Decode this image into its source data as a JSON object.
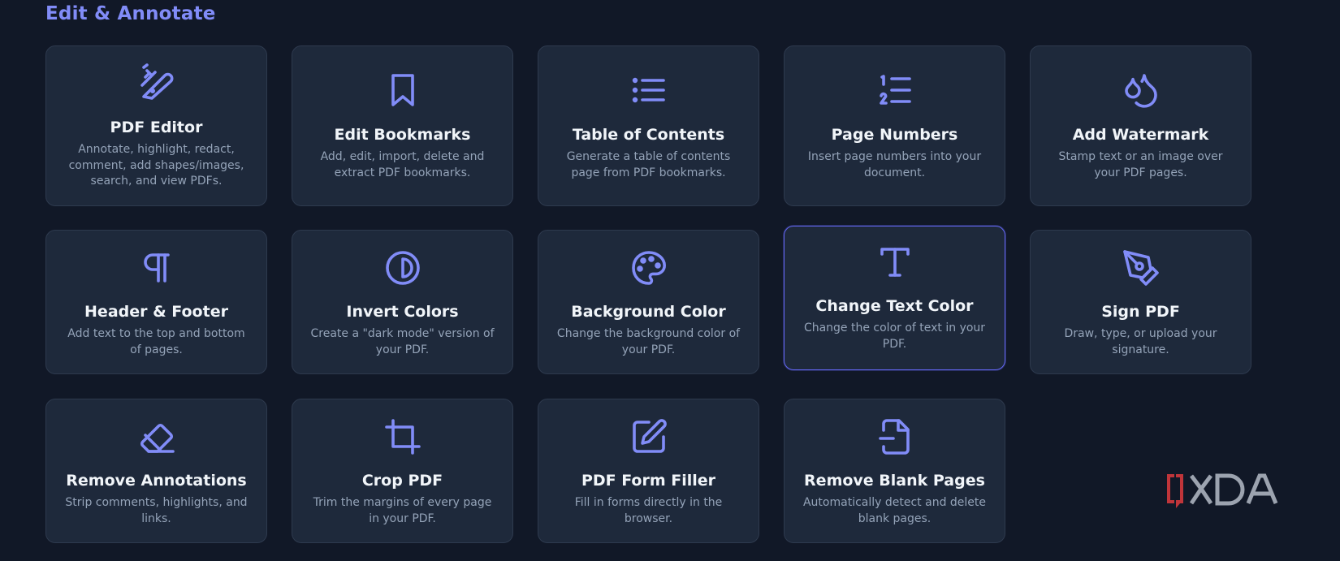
{
  "section": {
    "title": "Edit & Annotate"
  },
  "tools": [
    {
      "title": "PDF Editor",
      "description": "Annotate, highlight, redact, comment, add shapes/images, search, and view PDFs.",
      "icon": "swiss-knife-icon"
    },
    {
      "title": "Edit Bookmarks",
      "description": "Add, edit, import, delete and extract PDF bookmarks.",
      "icon": "bookmark-icon"
    },
    {
      "title": "Table of Contents",
      "description": "Generate a table of contents page from PDF bookmarks.",
      "icon": "list-icon"
    },
    {
      "title": "Page Numbers",
      "description": "Insert page numbers into your document.",
      "icon": "numbered-list-icon"
    },
    {
      "title": "Add Watermark",
      "description": "Stamp text or an image over your PDF pages.",
      "icon": "droplets-icon"
    },
    {
      "title": "Header & Footer",
      "description": "Add text to the top and bottom of pages.",
      "icon": "pilcrow-icon"
    },
    {
      "title": "Invert Colors",
      "description": "Create a \"dark mode\" version of your PDF.",
      "icon": "contrast-icon"
    },
    {
      "title": "Background Color",
      "description": "Change the background color of your PDF.",
      "icon": "palette-icon"
    },
    {
      "title": "Change Text Color",
      "description": "Change the color of text in your PDF.",
      "icon": "type-icon"
    },
    {
      "title": "Sign PDF",
      "description": "Draw, type, or upload your signature.",
      "icon": "pen-tool-icon"
    },
    {
      "title": "Remove Annotations",
      "description": "Strip comments, highlights, and links.",
      "icon": "eraser-icon"
    },
    {
      "title": "Crop PDF",
      "description": "Trim the margins of every page in your PDF.",
      "icon": "crop-icon"
    },
    {
      "title": "PDF Form Filler",
      "description": "Fill in forms directly in the browser.",
      "icon": "edit-square-icon"
    },
    {
      "title": "Remove Blank Pages",
      "description": "Automatically detect and delete blank pages.",
      "icon": "file-minus-icon"
    }
  ],
  "selected_tool": "Change Text Color",
  "watermark": {
    "brand": "XDA"
  },
  "colors": {
    "background": "#111827",
    "card": "#1e293b",
    "accent": "#818cf8",
    "selected_border": "#6366f1"
  }
}
